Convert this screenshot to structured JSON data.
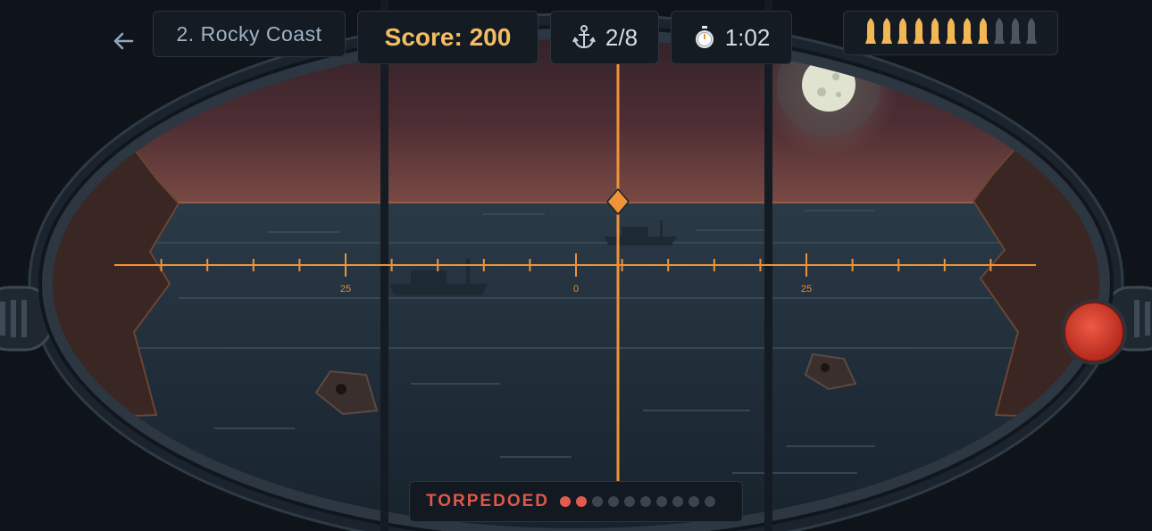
{
  "hud": {
    "back_icon": "arrow-left-icon",
    "level_label": "2. Rocky Coast",
    "score_label": "Score: 200",
    "ships_icon": "anchor-icon",
    "ships_label": "2/8",
    "timer_icon": "stopwatch-icon",
    "timer_label": "1:02",
    "torpedoes_total": 11,
    "torpedoes_remaining": 8
  },
  "scope": {
    "scale_left_label": "25",
    "scale_center_label": "0",
    "scale_right_label": "25"
  },
  "status": {
    "label": "TORPEDOED",
    "total": 10,
    "hits": 2
  },
  "colors": {
    "accent": "#f0923a",
    "score": "#f3bd63",
    "torpedo_live": "#f2b655",
    "torpedo_spent": "#4a5661",
    "alert": "#e35a4e",
    "fire_button": "#d93a2b"
  }
}
